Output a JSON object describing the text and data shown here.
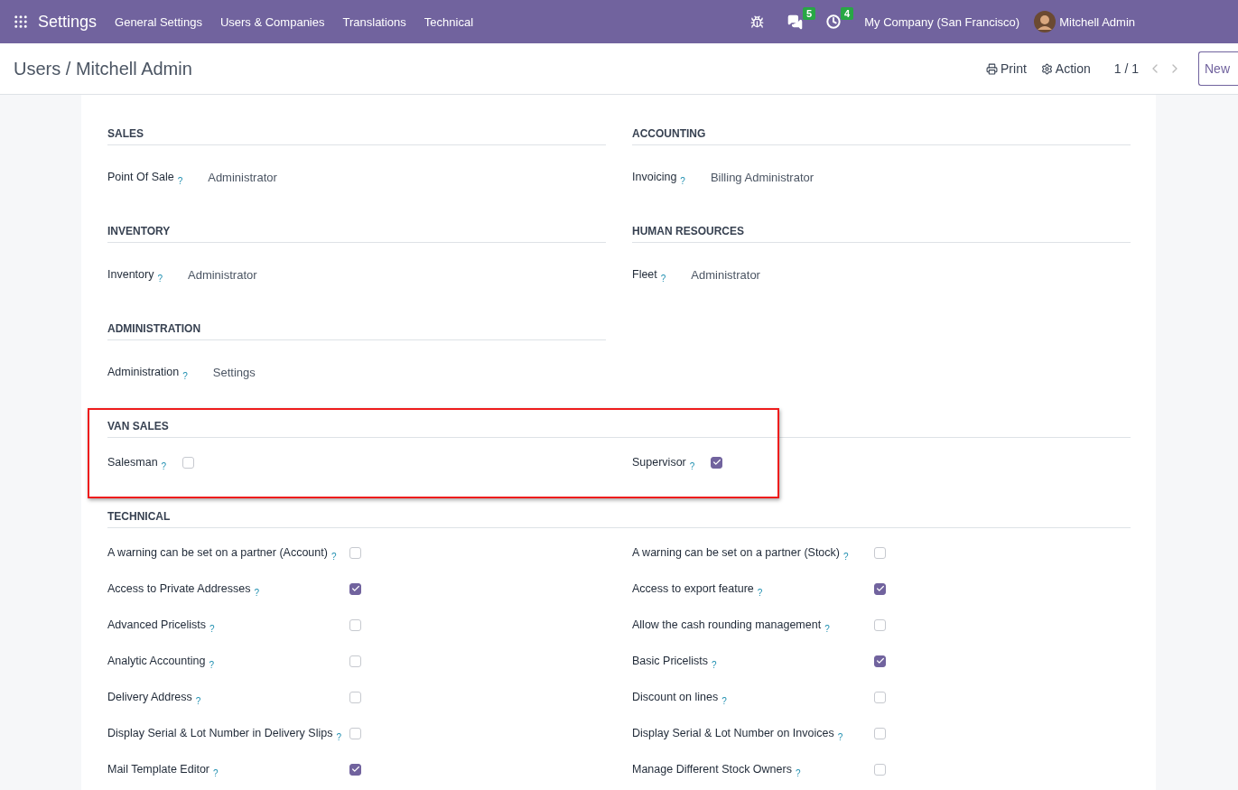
{
  "navbar": {
    "app_title": "Settings",
    "menu": [
      "General Settings",
      "Users & Companies",
      "Translations",
      "Technical"
    ],
    "messages_count": "5",
    "activities_count": "4",
    "company": "My Company (San Francisco)",
    "user": "Mitchell Admin"
  },
  "control_panel": {
    "breadcrumb": "Users / Mitchell Admin",
    "print": "Print",
    "action": "Action",
    "pager": "1 / 1",
    "new_button": "New"
  },
  "sections": [
    {
      "kind": "pair",
      "columns": [
        {
          "title": "SALES",
          "fields": [
            {
              "label": "Point Of Sale",
              "help": "?",
              "value": "Administrator"
            }
          ]
        },
        {
          "title": "ACCOUNTING",
          "fields": [
            {
              "label": "Invoicing",
              "help": "?",
              "value": "Billing Administrator"
            }
          ]
        }
      ]
    },
    {
      "kind": "pair",
      "columns": [
        {
          "title": "INVENTORY",
          "fields": [
            {
              "label": "Inventory",
              "help": "?",
              "value": "Administrator"
            }
          ]
        },
        {
          "title": "HUMAN RESOURCES",
          "fields": [
            {
              "label": "Fleet",
              "help": "?",
              "value": "Administrator"
            }
          ]
        }
      ]
    },
    {
      "kind": "pair",
      "columns": [
        {
          "title": "ADMINISTRATION",
          "fields": [
            {
              "label": "Administration",
              "help": "?",
              "value": "Settings"
            }
          ]
        }
      ]
    },
    {
      "kind": "inline_checks",
      "title": "VAN SALES",
      "highlighted": true,
      "items": [
        {
          "label": "Salesman",
          "help": "?",
          "checked": false
        },
        {
          "label": "Supervisor",
          "help": "?",
          "checked": true
        }
      ]
    },
    {
      "kind": "grid_checks",
      "title": "TECHNICAL",
      "highlighted": false,
      "items": [
        {
          "label": "A warning can be set on a partner (Account)",
          "help": "?",
          "checked": false
        },
        {
          "label": "A warning can be set on a partner (Stock)",
          "help": "?",
          "checked": false
        },
        {
          "label": "Access to Private Addresses",
          "help": "?",
          "checked": true
        },
        {
          "label": "Access to export feature",
          "help": "?",
          "checked": true
        },
        {
          "label": "Advanced Pricelists",
          "help": "?",
          "checked": false
        },
        {
          "label": "Allow the cash rounding management",
          "help": "?",
          "checked": false
        },
        {
          "label": "Analytic Accounting",
          "help": "?",
          "checked": false
        },
        {
          "label": "Basic Pricelists",
          "help": "?",
          "checked": true
        },
        {
          "label": "Delivery Address",
          "help": "?",
          "checked": false
        },
        {
          "label": "Discount on lines",
          "help": "?",
          "checked": false
        },
        {
          "label": "Display Serial & Lot Number in Delivery Slips",
          "help": "?",
          "checked": false
        },
        {
          "label": "Display Serial & Lot Number on Invoices",
          "help": "?",
          "checked": false
        },
        {
          "label": "Mail Template Editor",
          "help": "?",
          "checked": true
        },
        {
          "label": "Manage Different Stock Owners",
          "help": "?",
          "checked": false
        }
      ]
    }
  ]
}
